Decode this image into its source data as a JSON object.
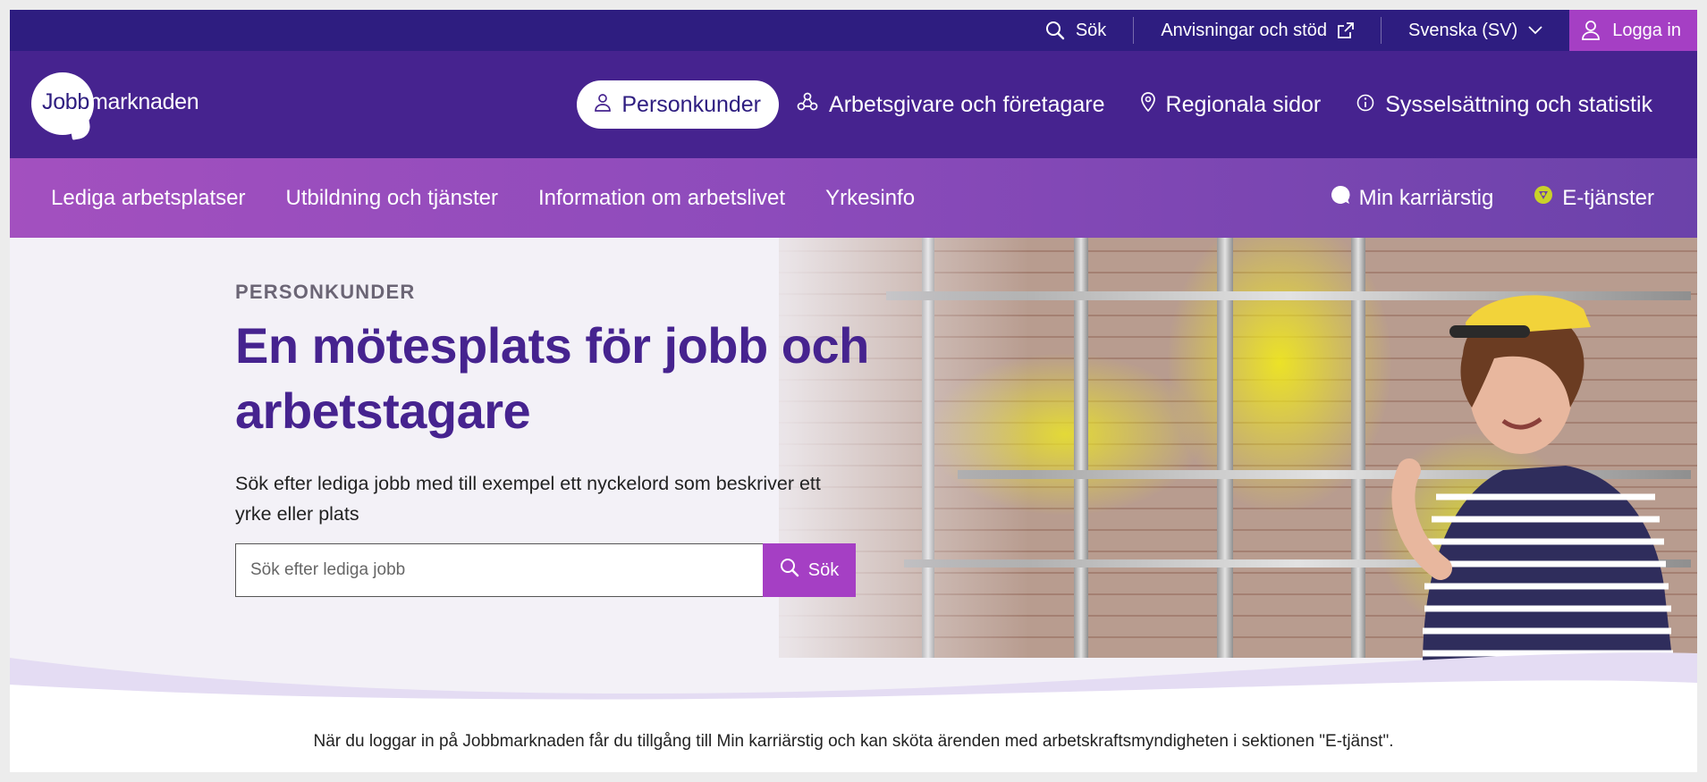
{
  "utility": {
    "search_label": "Sök",
    "guidance_label": "Anvisningar och stöd",
    "language_label": "Svenska (SV)",
    "login_label": "Logga in"
  },
  "header": {
    "logo_part1": "Jobb",
    "logo_part2": "marknaden",
    "nav": [
      {
        "label": "Personkunder",
        "icon": "person-icon"
      },
      {
        "label": "Arbetsgivare och företagare",
        "icon": "network-icon"
      },
      {
        "label": "Regionala sidor",
        "icon": "map-pin-icon"
      },
      {
        "label": "Sysselsättning och statistik",
        "icon": "info-icon"
      }
    ]
  },
  "subnav": {
    "left": [
      "Lediga arbetsplatser",
      "Utbildning och tjänster",
      "Information om arbetslivet",
      "Yrkesinfo"
    ],
    "career_label": "Min karriärstig",
    "eservices_label": "E-tjänster"
  },
  "hero": {
    "eyebrow": "PERSONKUNDER",
    "title_line1": "En mötesplats för jobb och",
    "title_line2": "arbetstagare",
    "description": "Sök efter lediga jobb med till exempel ett nyckelord som beskriver ett yrke eller plats",
    "search_placeholder": "Sök efter lediga jobb",
    "search_button": "Sök"
  },
  "info_text": "När du loggar in på Jobbmarknaden får du tillgång till Min karriärstig och kan sköta ärenden med arbetskraftsmyndigheten i sektionen \"E-tjänst\".",
  "colors": {
    "utility_bg": "#2e1d80",
    "header_bg": "#46238f",
    "accent": "#a53fc4",
    "title": "#46238f"
  }
}
